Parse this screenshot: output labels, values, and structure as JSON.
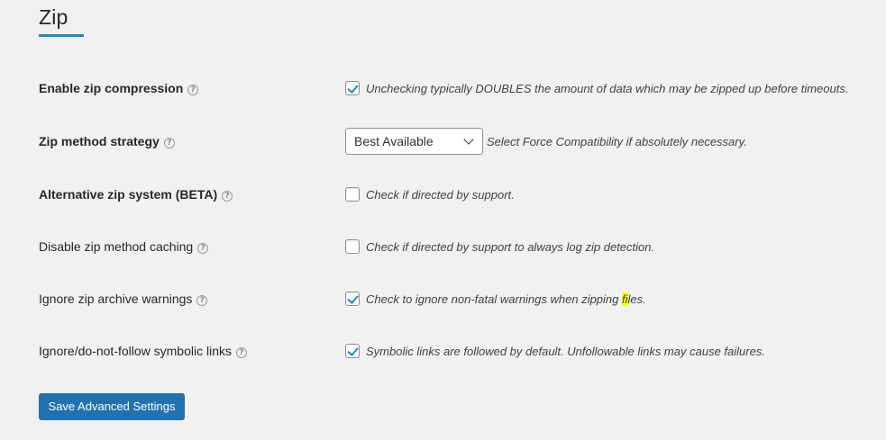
{
  "section": {
    "title": "Zip"
  },
  "settings": [
    {
      "label": "Enable zip compression",
      "bold": true,
      "checked": true,
      "description": "Unchecking typically DOUBLES the amount of data which may be zipped up before timeouts."
    },
    {
      "label": "Zip method strategy",
      "bold": true,
      "select_value": "Best Available",
      "description": "Select Force Compatibility if absolutely necessary."
    },
    {
      "label": "Alternative zip system (BETA)",
      "bold": true,
      "checked": false,
      "description": "Check if directed by support."
    },
    {
      "label": "Disable zip method caching",
      "bold": false,
      "checked": false,
      "description": "Check if directed by support to always log zip detection."
    },
    {
      "label": "Ignore zip archive warnings",
      "bold": false,
      "checked": true,
      "description_pre": "Check to ignore non-fatal warnings when zipping ",
      "description_highlight": "fi",
      "description_post": "les."
    },
    {
      "label": "Ignore/do-not-follow symbolic links",
      "bold": false,
      "checked": true,
      "description": "Symbolic links are followed by default. Unfollowable links may cause failures."
    }
  ],
  "help_icon_glyph": "?",
  "save_button_label": "Save Advanced Settings",
  "colors": {
    "accent": "#2271b1",
    "checkmark": "#1e8cbe",
    "highlight": "#ffff00",
    "background": "#f1f1f1"
  }
}
